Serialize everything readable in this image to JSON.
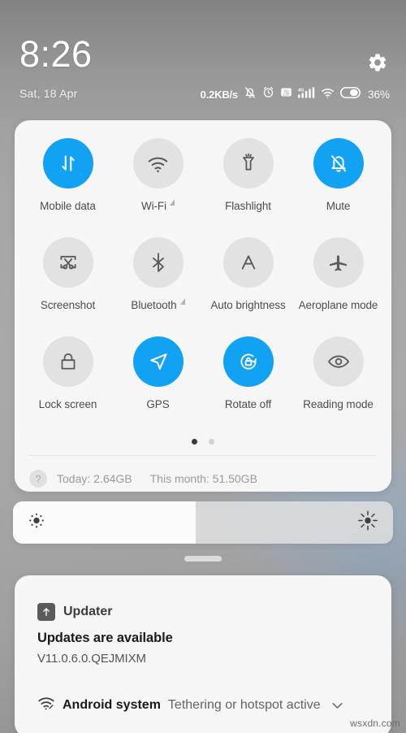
{
  "statusbar": {
    "clock": "8:26",
    "date": "Sat, 18 Apr",
    "network_speed": "0.2KB/s",
    "battery_percent": "36%",
    "settings_icon": "gear-icon",
    "icons": [
      "bell-muted-icon",
      "alarm-clock-icon",
      "volte-icon",
      "signal-4g-icon",
      "wifi-icon",
      "battery-icon"
    ]
  },
  "quick_settings": {
    "tiles": [
      {
        "label": "Mobile data",
        "icon": "mobile-data-icon",
        "active": true,
        "expandable": false
      },
      {
        "label": "Wi-Fi",
        "icon": "wifi-icon",
        "active": false,
        "expandable": true
      },
      {
        "label": "Flashlight",
        "icon": "flashlight-icon",
        "active": false,
        "expandable": false
      },
      {
        "label": "Mute",
        "icon": "bell-muted-icon",
        "active": true,
        "expandable": false
      },
      {
        "label": "Screenshot",
        "icon": "screenshot-icon",
        "active": false,
        "expandable": false
      },
      {
        "label": "Bluetooth",
        "icon": "bluetooth-icon",
        "active": false,
        "expandable": true
      },
      {
        "label": "Auto brightness",
        "icon": "auto-brightness-icon",
        "active": false,
        "expandable": false
      },
      {
        "label": "Aeroplane mode",
        "icon": "aeroplane-icon",
        "active": false,
        "expandable": false
      },
      {
        "label": "Lock screen",
        "icon": "padlock-icon",
        "active": false,
        "expandable": false
      },
      {
        "label": "GPS",
        "icon": "navigation-arrow-icon",
        "active": true,
        "expandable": false
      },
      {
        "label": "Rotate off",
        "icon": "rotation-lock-icon",
        "active": true,
        "expandable": false
      },
      {
        "label": "Reading mode",
        "icon": "eye-icon",
        "active": false,
        "expandable": false
      }
    ],
    "pages": {
      "count": 2,
      "current": 1
    },
    "data_usage": {
      "help_glyph": "?",
      "today": "Today: 2.64GB",
      "month": "This month: 51.50GB"
    }
  },
  "brightness": {
    "value_percent": 48,
    "low_icon": "brightness-low-icon",
    "high_icon": "brightness-high-icon"
  },
  "drag_handle": "panel-drag-handle",
  "notifications": [
    {
      "app": "Updater",
      "app_icon": "updater-arrow-icon",
      "title": "Updates are available",
      "subtitle": "V11.0.6.0.QEJMIXM"
    },
    {
      "app": "Android system",
      "app_icon": "wifi-tether-icon",
      "text": "Tethering or hotspot active",
      "chevron": "chevron-down-icon"
    }
  ],
  "watermark": "wsxdn.com",
  "colors": {
    "accent_blue": "#11a2f3",
    "tile_inactive": "#e2e2e2",
    "panel_bg": "#f6f6f6"
  }
}
